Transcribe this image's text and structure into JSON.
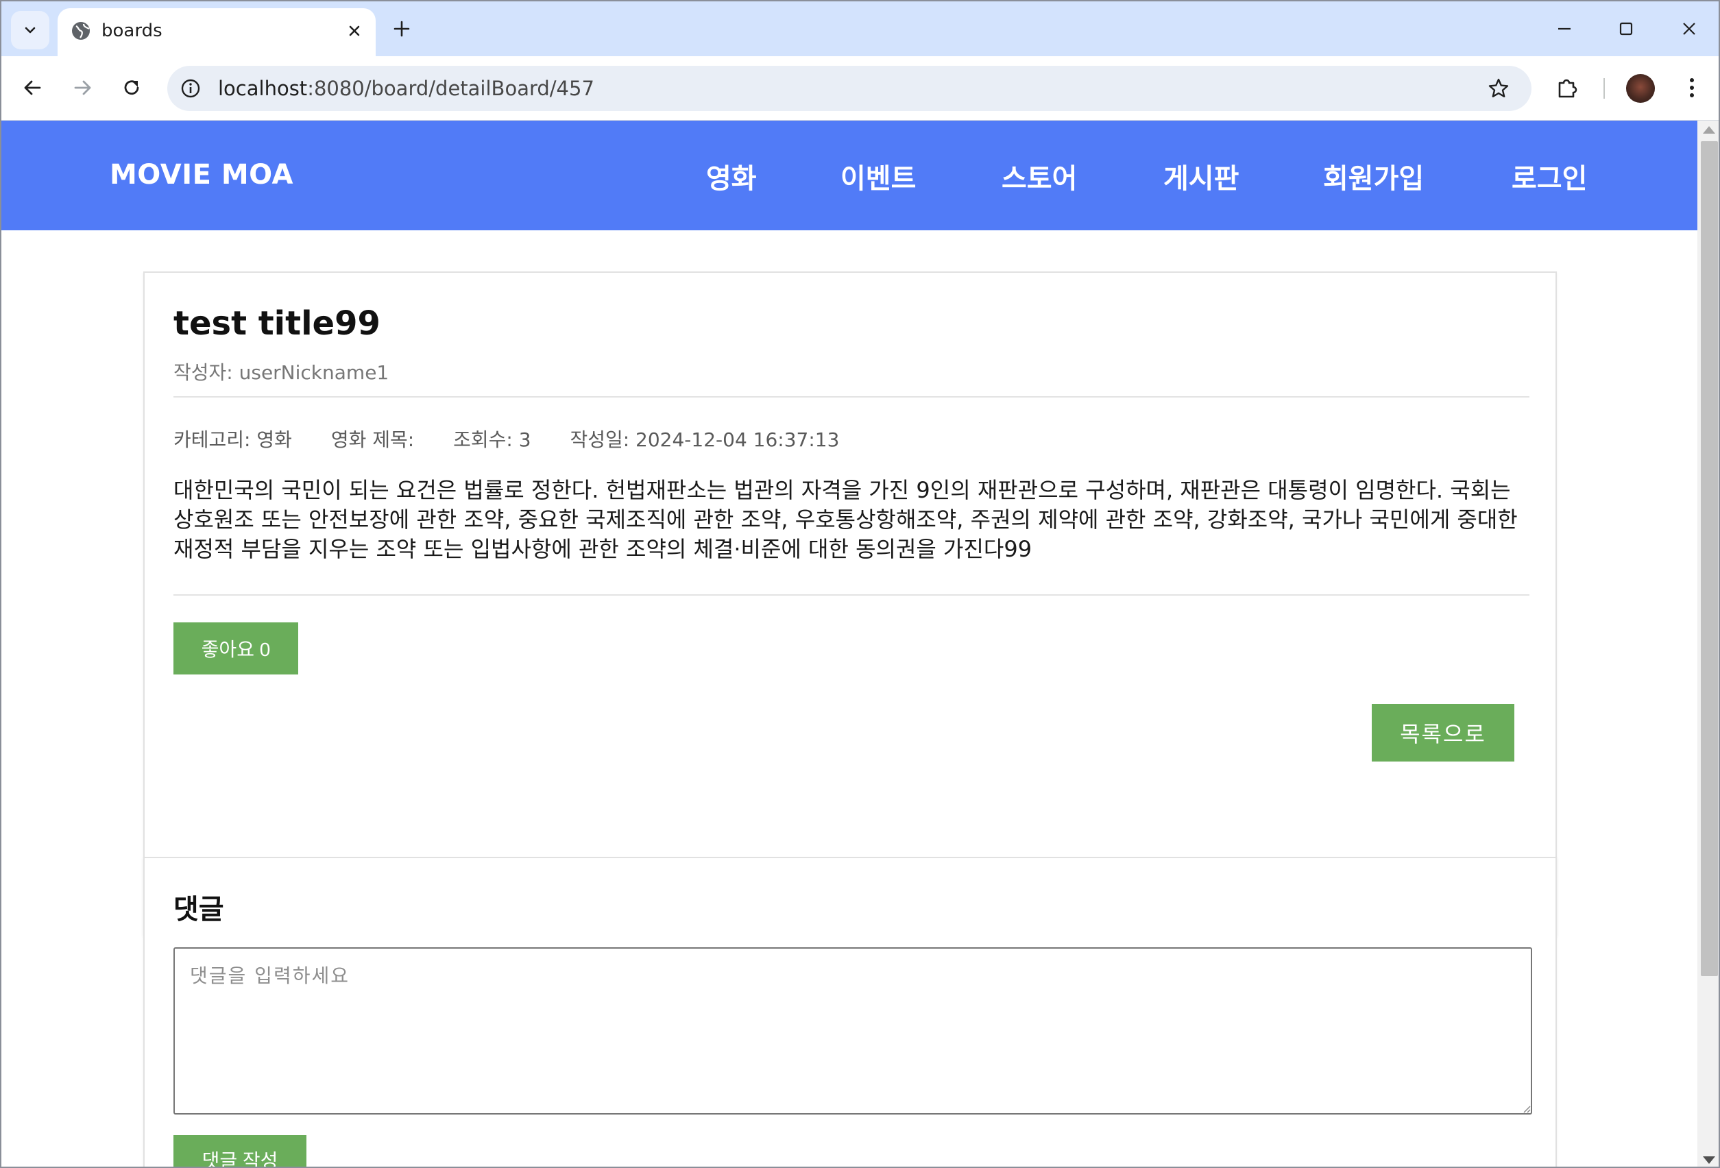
{
  "browser": {
    "tab_title": "boards",
    "url_host": "localhost",
    "url_rest": ":8080/board/detailBoard/457"
  },
  "site": {
    "brand": "MOVIE MOA",
    "nav": [
      "영화",
      "이벤트",
      "스토어",
      "게시판",
      "회원가입",
      "로그인"
    ]
  },
  "post": {
    "title": "test title99",
    "author": "작성자: userNickname1",
    "category": "카테고리: 영화",
    "movie_title": "영화 제목:",
    "views": "조회수: 3",
    "created": "작성일: 2024-12-04 16:37:13",
    "content": "대한민국의 국민이 되는 요건은 법률로 정한다. 헌법재판소는 법관의 자격을 가진 9인의 재판관으로 구성하며, 재판관은 대통령이 임명한다. 국회는 상호원조 또는 안전보장에 관한 조약, 중요한 국제조직에 관한 조약, 우호통상항해조약, 주권의 제약에 관한 조약, 강화조약, 국가나 국민에게 중대한 재정적 부담을 지우는 조약 또는 입법사항에 관한 조약의 체결·비준에 대한 동의권을 가진다99",
    "like_label": "좋아요 0",
    "list_label": "목록으로"
  },
  "comments": {
    "heading": "댓글",
    "placeholder": "댓글을 입력하세요",
    "submit_label": "댓글 작성"
  },
  "colors": {
    "header_bg": "#517bf7",
    "button_green": "#6aad5a",
    "tabstrip_bg": "#d3e3fd"
  }
}
